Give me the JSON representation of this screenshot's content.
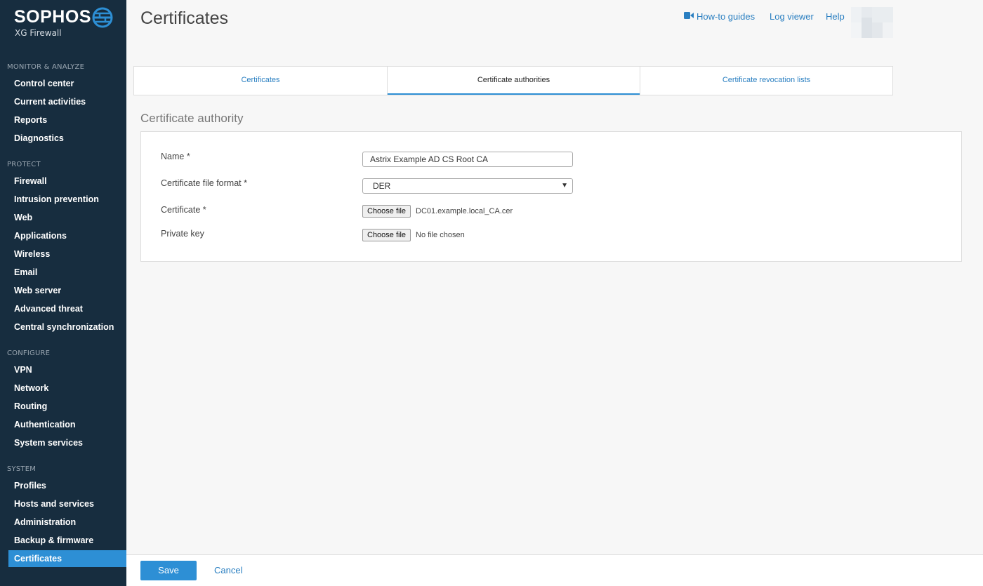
{
  "brand": {
    "name": "SOPHOS",
    "product": "XG Firewall"
  },
  "sidebar": {
    "sections": [
      {
        "label": "MONITOR & ANALYZE",
        "items": [
          "Control center",
          "Current activities",
          "Reports",
          "Diagnostics"
        ]
      },
      {
        "label": "PROTECT",
        "items": [
          "Firewall",
          "Intrusion prevention",
          "Web",
          "Applications",
          "Wireless",
          "Email",
          "Web server",
          "Advanced threat",
          "Central synchronization"
        ]
      },
      {
        "label": "CONFIGURE",
        "items": [
          "VPN",
          "Network",
          "Routing",
          "Authentication",
          "System services"
        ]
      },
      {
        "label": "SYSTEM",
        "items": [
          "Profiles",
          "Hosts and services",
          "Administration",
          "Backup & firmware",
          "Certificates"
        ]
      }
    ],
    "active_item": "Certificates"
  },
  "header": {
    "title": "Certificates",
    "links": {
      "guides": "How-to guides",
      "log": "Log viewer",
      "help": "Help"
    }
  },
  "tabs": [
    "Certificates",
    "Certificate authorities",
    "Certificate revocation lists"
  ],
  "active_tab": "Certificate authorities",
  "form": {
    "section_title": "Certificate authority",
    "name_label": "Name *",
    "name_value": "Astrix Example AD CS Root CA",
    "format_label": "Certificate file format *",
    "format_value": "DER",
    "certificate_label": "Certificate *",
    "certificate_button": "Choose file",
    "certificate_file": "DC01.example.local_CA.cer",
    "private_key_label": "Private key",
    "private_key_button": "Choose file",
    "private_key_file": "No file chosen"
  },
  "footer": {
    "save": "Save",
    "cancel": "Cancel"
  },
  "colors": {
    "sidebar_bg": "#172d3f",
    "accent": "#2d8fd5",
    "link": "#2a7fc1"
  }
}
